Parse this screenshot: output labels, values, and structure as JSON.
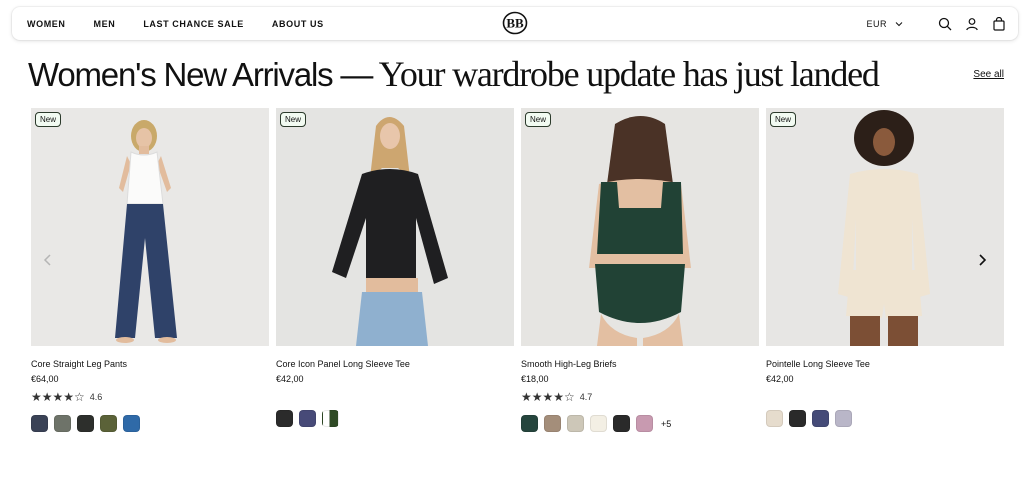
{
  "nav": {
    "items": [
      "WOMEN",
      "MEN",
      "LAST CHANCE SALE",
      "ABOUT US"
    ],
    "currency": "EUR"
  },
  "section": {
    "title_sans": "Women's New Arrivals —",
    "title_serif": " Your wardrobe update has just landed",
    "see_all": "See all"
  },
  "products": [
    {
      "badge": "New",
      "name": "Core Straight Leg Pants",
      "price": "€64,00",
      "rating": "4.6",
      "rating_value": 4.6,
      "swatches": [
        "#3a4256",
        "#6e7369",
        "#2d2f2c",
        "#5b6238",
        "#2f6aa8"
      ]
    },
    {
      "badge": "New",
      "name": "Core Icon Panel Long Sleeve Tee",
      "price": "€42,00",
      "swatches": [
        "#2b2b2b",
        "#474a78",
        "#2f4a25"
      ]
    },
    {
      "badge": "New",
      "name": "Smooth High-Leg Briefs",
      "price": "€18,00",
      "rating": "4.7",
      "rating_value": 4.7,
      "swatches": [
        "#25453d",
        "#a48e7a",
        "#cdc7b8",
        "#f3efe4",
        "#2a2a2a",
        "#c89ab0"
      ],
      "more": "+5"
    },
    {
      "badge": "New",
      "name": "Pointelle Long Sleeve Tee",
      "price": "€42,00",
      "swatches": [
        "#e6dccd",
        "#2a2a2a",
        "#454b78",
        "#b9b6c8"
      ]
    }
  ]
}
